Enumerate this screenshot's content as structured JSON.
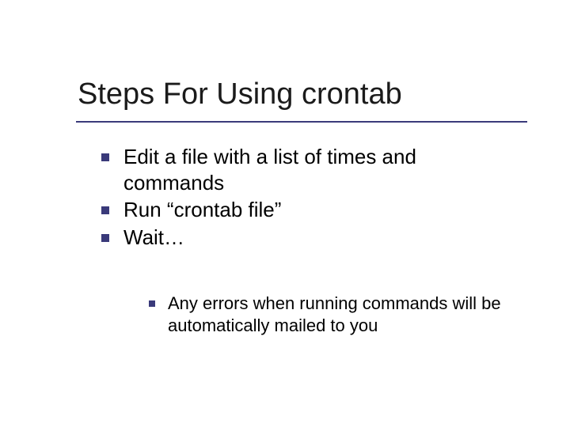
{
  "title": "Steps For Using crontab",
  "bullets": [
    {
      "text": "Edit a file with a list of times and commands"
    },
    {
      "text": "Run “crontab file”"
    },
    {
      "text": "Wait…"
    }
  ],
  "subbullets": [
    {
      "text": "Any errors when running commands will be automatically mailed to you"
    }
  ]
}
